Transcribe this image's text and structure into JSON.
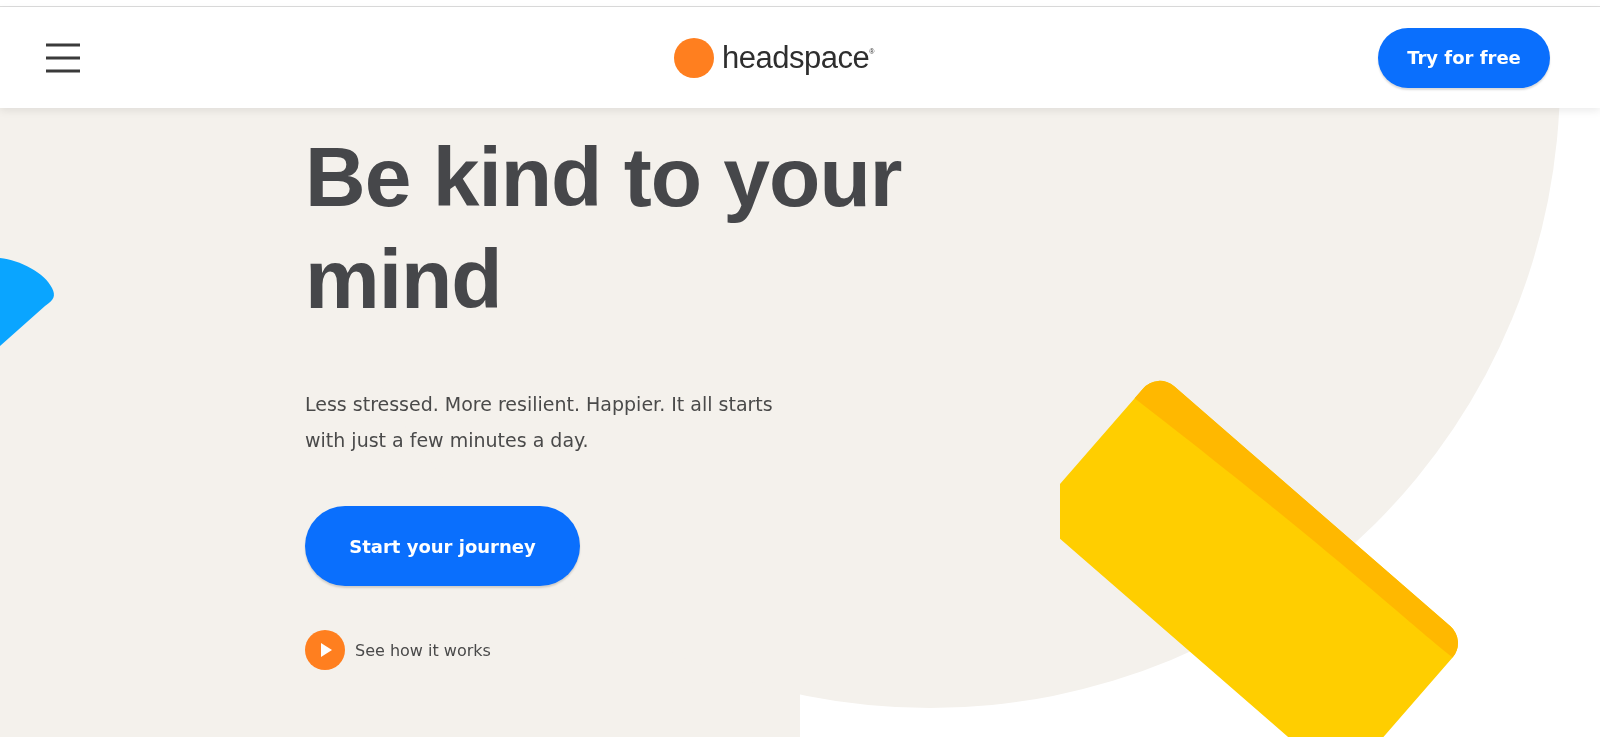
{
  "header": {
    "logo": "headspace",
    "logo_mark": "®",
    "cta": "Try for free"
  },
  "hero": {
    "title": "Be kind to your mind",
    "subtitle": "Less stressed. More resilient. Happier. It all starts with just a few minutes a day.",
    "button": "Start your journey",
    "video_link": "See how it works"
  }
}
